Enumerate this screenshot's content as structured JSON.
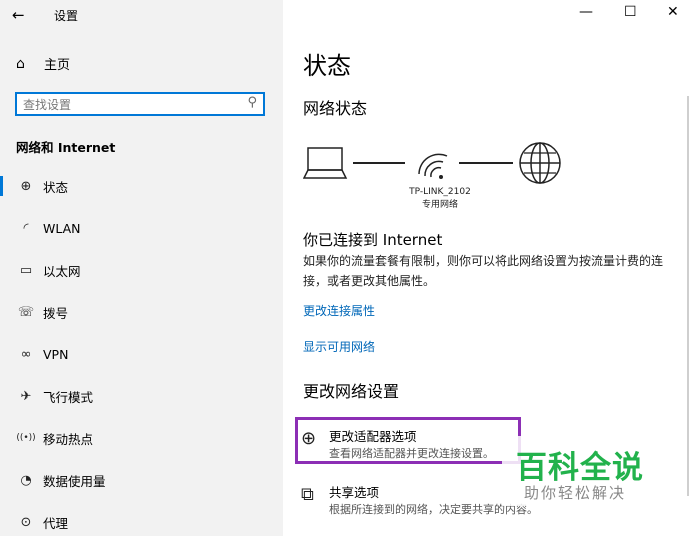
{
  "window": {
    "title": "设置",
    "controls": {
      "minimize": "—",
      "maximize": "☐",
      "close": "✕"
    }
  },
  "sidebar": {
    "home_label": "主页",
    "search_placeholder": "查找设置",
    "section": "网络和 Internet",
    "items": [
      {
        "label": "状态",
        "icon": "globe-status-icon",
        "glyph": "⊕"
      },
      {
        "label": "WLAN",
        "icon": "wifi-icon",
        "glyph": "◜"
      },
      {
        "label": "以太网",
        "icon": "ethernet-icon",
        "glyph": "▭"
      },
      {
        "label": "拨号",
        "icon": "dialup-icon",
        "glyph": "☏"
      },
      {
        "label": "VPN",
        "icon": "vpn-icon",
        "glyph": "∞"
      },
      {
        "label": "飞行模式",
        "icon": "airplane-icon",
        "glyph": "✈"
      },
      {
        "label": "移动热点",
        "icon": "hotspot-icon",
        "glyph": "((•))"
      },
      {
        "label": "数据使用量",
        "icon": "data-usage-icon",
        "glyph": "◔"
      },
      {
        "label": "代理",
        "icon": "proxy-icon",
        "glyph": "⊙"
      }
    ]
  },
  "main": {
    "title": "状态",
    "network_status_heading": "网络状态",
    "router_name": "TP-LINK_2102",
    "network_type": "专用网络",
    "connected_heading": "你已连接到 Internet",
    "connected_desc": "如果你的流量套餐有限制，则你可以将此网络设置为按流量计费的连接，或者更改其他属性。",
    "link_change_properties": "更改连接属性",
    "link_show_networks": "显示可用网络",
    "change_settings_heading": "更改网络设置",
    "options": [
      {
        "title": "更改适配器选项",
        "desc": "查看网络适配器并更改连接设置。"
      },
      {
        "title": "共享选项",
        "desc": "根据所连接到的网络，决定要共享的内容。"
      }
    ]
  },
  "watermark": {
    "main": "百科全说",
    "sub": "助你轻松解决"
  },
  "colors": {
    "accent": "#0078d7",
    "link": "#0067b8",
    "highlight": "#8c2fb5",
    "watermark": "#22b24c"
  }
}
